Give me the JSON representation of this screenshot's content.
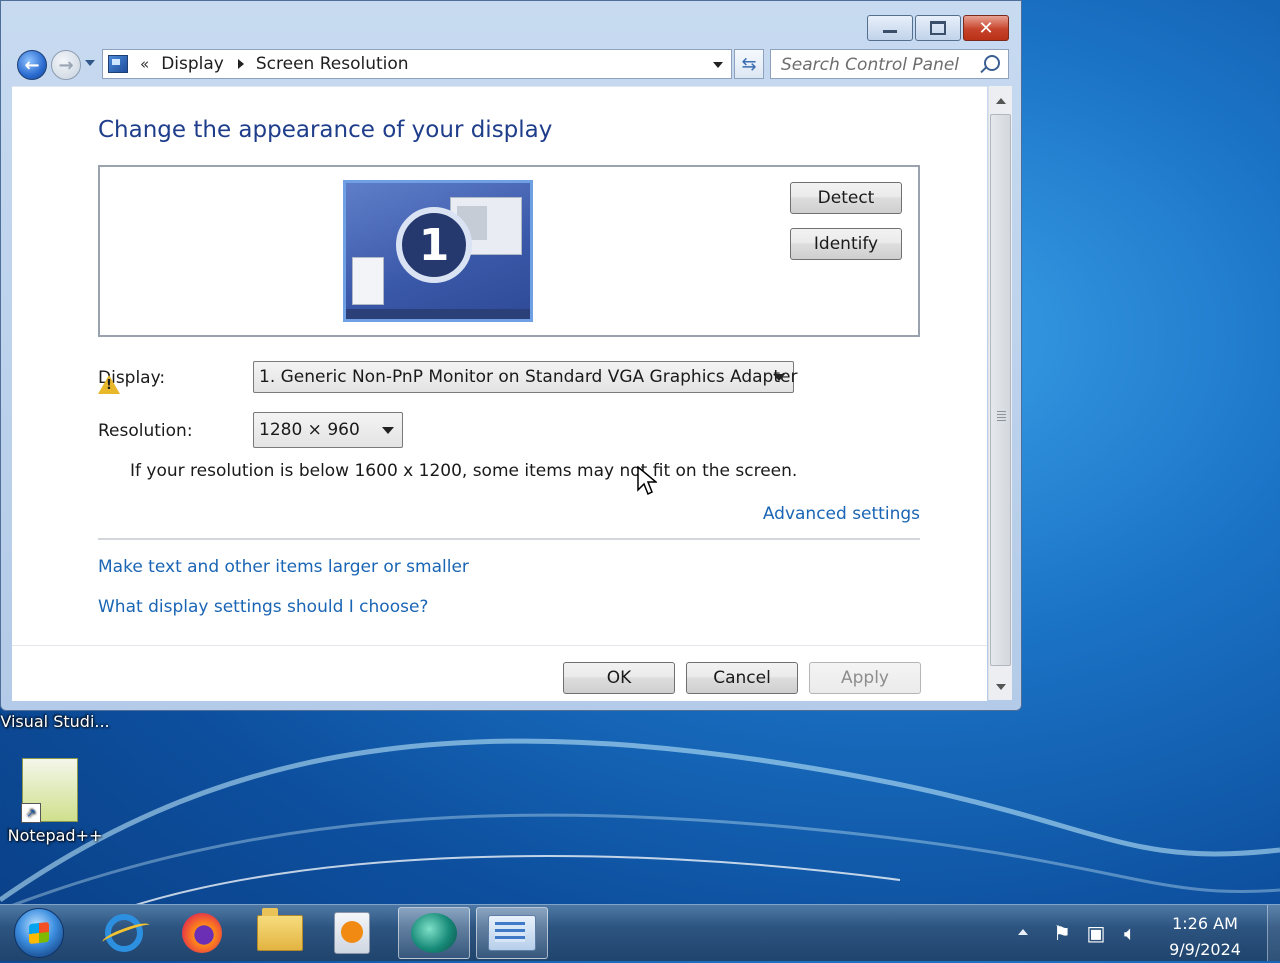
{
  "window": {
    "address": {
      "chevron": "«",
      "crumbs": [
        "Display",
        "Screen Resolution"
      ]
    },
    "search_placeholder": "Search Control Panel"
  },
  "content": {
    "title": "Change the appearance of your display",
    "monitor_number": "1",
    "detect_label": "Detect",
    "identify_label": "Identify",
    "display_label": "Display:",
    "display_value": "1. Generic Non-PnP Monitor on Standard VGA Graphics Adapter",
    "resolution_label": "Resolution:",
    "resolution_value": "1280 × 960",
    "warning_text": "If your resolution is below 1600 x 1200, some items may not fit on the screen.",
    "advanced_link": "Advanced settings",
    "links": [
      "Make text and other items larger or smaller",
      "What display settings should I choose?"
    ],
    "ok_label": "OK",
    "cancel_label": "Cancel",
    "apply_label": "Apply"
  },
  "desktop": {
    "icons": [
      "Visual Studi...",
      "Notepad++"
    ]
  },
  "taskbar": {
    "clock_time": "1:26 AM",
    "clock_date": "9/9/2024",
    "pinned": [
      "internet-explorer-icon",
      "firefox-icon",
      "file-explorer-icon",
      "media-player-icon",
      "app-icon",
      "control-panel-icon"
    ]
  },
  "colors": {
    "title_blue": "#1e3d8a",
    "link_blue": "#1a65b4"
  }
}
